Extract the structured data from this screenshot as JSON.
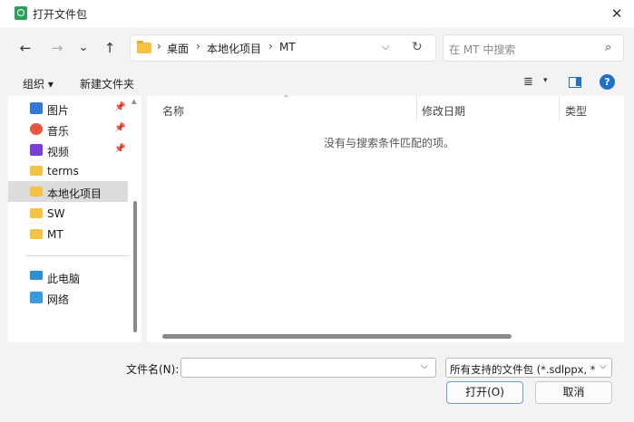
{
  "window": {
    "title": "打开文件包",
    "close_symbol": "✕"
  },
  "nav": {
    "back": "←",
    "forward": "→",
    "recent": "⌄",
    "up": "↑",
    "breadcrumb": [
      "桌面",
      "本地化项目",
      "MT"
    ],
    "separator": "›",
    "dropdown": "⌵",
    "refresh": "↻"
  },
  "search": {
    "placeholder": "在 MT 中搜索",
    "icon": "⌕"
  },
  "commands": {
    "organize": "组织 ▾",
    "new_folder": "新建文件夹",
    "view_icon": "≣",
    "view_dropdown": "▾",
    "help": "?"
  },
  "navpane": {
    "pin": "📌",
    "items": [
      {
        "label": "图片",
        "icon": "pictures-icon",
        "pinned": true
      },
      {
        "label": "音乐",
        "icon": "music-icon",
        "pinned": true
      },
      {
        "label": "视频",
        "icon": "videos-icon",
        "pinned": true
      },
      {
        "label": "terms",
        "icon": "folder-icon",
        "pinned": false
      },
      {
        "label": "本地化项目",
        "icon": "folder-icon",
        "pinned": false,
        "selected": true
      },
      {
        "label": "SW",
        "icon": "folder-icon",
        "pinned": false
      },
      {
        "label": "MT",
        "icon": "folder-icon",
        "pinned": false
      },
      {
        "label": "此电脑",
        "icon": "this-pc-icon",
        "pinned": false
      },
      {
        "label": "网络",
        "icon": "network-icon",
        "pinned": false
      }
    ]
  },
  "filelist": {
    "columns": [
      "名称",
      "修改日期",
      "类型"
    ],
    "sort_indicator": "^",
    "empty_message": "没有与搜索条件匹配的项。"
  },
  "footer": {
    "filename_label": "文件名(N):",
    "filename_value": "",
    "filetype": "所有支持的文件包 (*.sdlppx, *.s",
    "dropdown": "⌵",
    "open_button": "打开(O)",
    "cancel_button": "取消"
  }
}
